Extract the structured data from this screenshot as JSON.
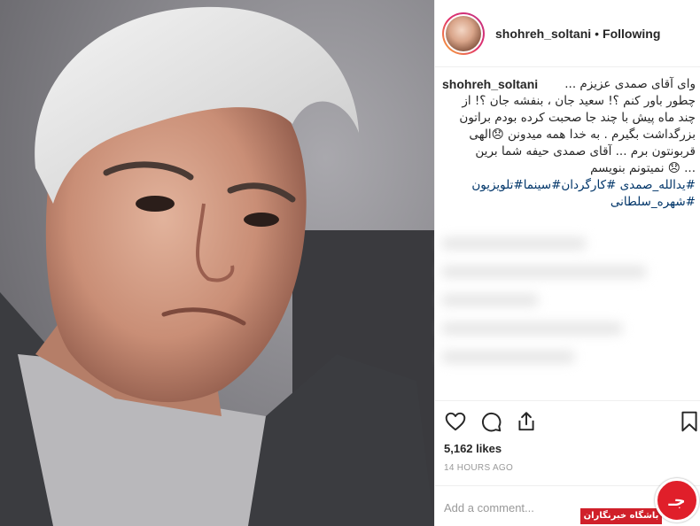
{
  "header": {
    "username": "shohreh_soltani",
    "separator": "•",
    "follow_status": "Following"
  },
  "caption": {
    "username": "shohreh_soltani",
    "lines": [
      "وای آقای صمدی عزیزم ...",
      "چطور باور کنم ؟! سعید جان ، بنفشه جان ؟! از",
      "چند ماه پیش با چند جا صحبت کرده بودم براتون",
      "بزرگداشت بگیرم . به خدا همه میدونن 😞الهی",
      "قربونتون برم ... آقای صمدی حیفه شما برین",
      "... 😞 نمیتونم بنویسم"
    ],
    "hashtags_line1": "#یدالله_صمدی #کارگردان#سینما#تلویزیون",
    "hashtags_line2": "#شهره_سلطانی"
  },
  "actions": {
    "like_icon": "heart-icon",
    "comment_icon": "comment-icon",
    "share_icon": "share-icon",
    "save_icon": "bookmark-icon"
  },
  "likes": "5,162 likes",
  "timestamp": "14 HOURS AGO",
  "comment": {
    "placeholder": "Add a comment...",
    "value": ""
  },
  "watermark": {
    "text": "باشگاه خبرنگاران",
    "logo_letter": "جـ"
  },
  "colors": {
    "text": "#262626",
    "muted": "#999999",
    "hashtag": "#003569",
    "border": "#efefef",
    "watermark_red": "#d0202a"
  }
}
